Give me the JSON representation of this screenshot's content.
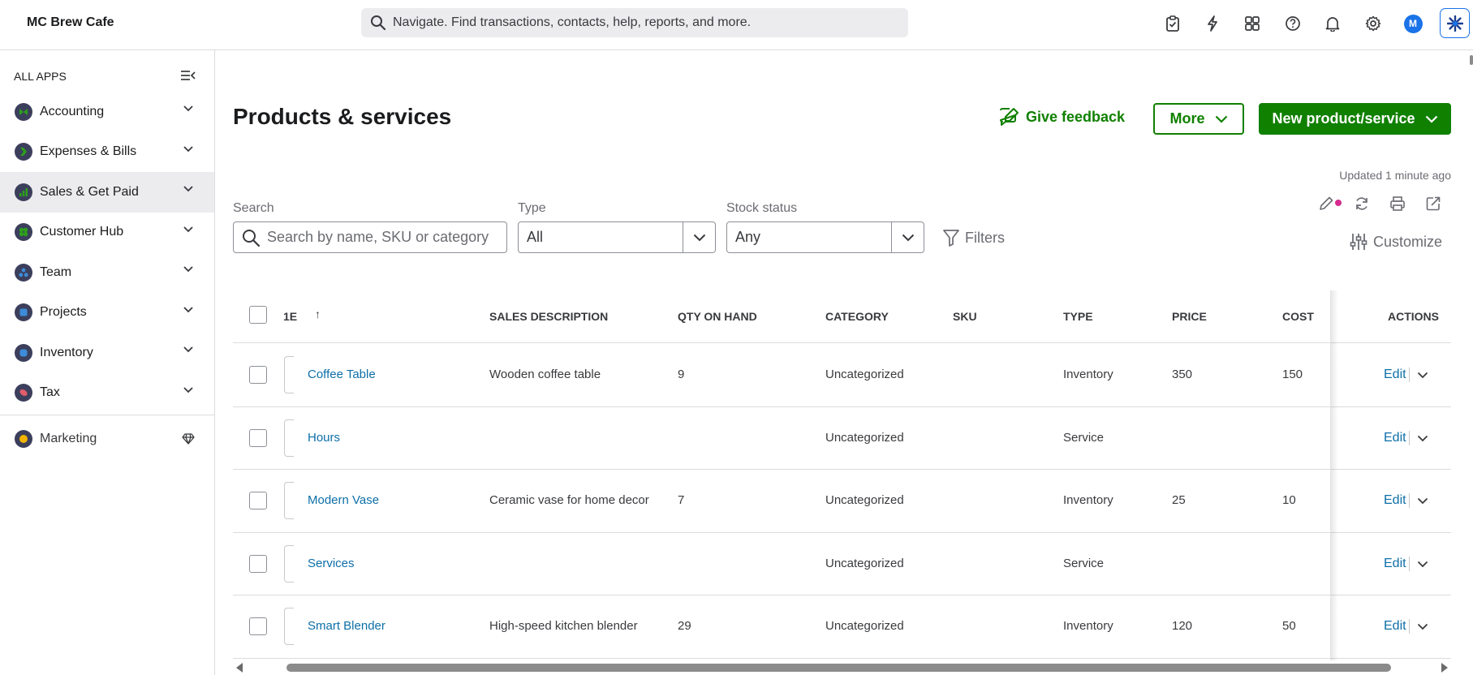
{
  "topbar": {
    "company_name": "MC Brew Cafe",
    "search_placeholder": "Navigate. Find transactions, contacts, help, reports, and more.",
    "avatar_initial": "M",
    "icons": [
      "clipboard-icon",
      "lightning-icon",
      "apps-icon",
      "help-icon",
      "bell-icon",
      "gear-icon",
      "avatar",
      "ai-assistant-icon"
    ]
  },
  "sidebar": {
    "heading": "ALL APPS",
    "items": [
      {
        "label": "Accounting",
        "icon_color": "#2ca01c"
      },
      {
        "label": "Expenses & Bills",
        "icon_color": "#2ca01c"
      },
      {
        "label": "Sales & Get Paid",
        "icon_color": "#2ca01c",
        "active": true
      },
      {
        "label": "Customer Hub",
        "icon_color": "#2ca01c"
      },
      {
        "label": "Team",
        "icon_color": "#3d8cd9"
      },
      {
        "label": "Projects",
        "icon_color": "#3d8cd9"
      },
      {
        "label": "Inventory",
        "icon_color": "#3d8cd9"
      },
      {
        "label": "Tax",
        "icon_color": "#e05c6b"
      }
    ],
    "marketing_label": "Marketing"
  },
  "page": {
    "title": "Products & services",
    "give_feedback": "Give feedback",
    "more_label": "More",
    "new_label": "New product/service",
    "updated_text": "Updated 1 minute ago",
    "customize_label": "Customize"
  },
  "filters": {
    "search_label": "Search",
    "search_placeholder": "Search by name, SKU or category",
    "type_label": "Type",
    "type_value": "All",
    "stock_label": "Stock status",
    "stock_value": "Any",
    "filters_label": "Filters"
  },
  "table": {
    "headers": {
      "name": "1E",
      "sort_arrow": "↑",
      "sales_description": "SALES DESCRIPTION",
      "qty_on_hand": "QTY ON HAND",
      "category": "CATEGORY",
      "sku": "SKU",
      "type": "TYPE",
      "price": "PRICE",
      "cost": "COST",
      "actions": "ACTIONS"
    },
    "edit_label": "Edit",
    "rows": [
      {
        "name": "Coffee Table",
        "description": "Wooden coffee table",
        "qty": "9",
        "category": "Uncategorized",
        "sku": "",
        "type": "Inventory",
        "price": "350",
        "cost": "150"
      },
      {
        "name": "Hours",
        "description": "",
        "qty": "",
        "category": "Uncategorized",
        "sku": "",
        "type": "Service",
        "price": "",
        "cost": ""
      },
      {
        "name": "Modern Vase",
        "description": "Ceramic vase for home decor",
        "qty": "7",
        "category": "Uncategorized",
        "sku": "",
        "type": "Inventory",
        "price": "25",
        "cost": "10"
      },
      {
        "name": "Services",
        "description": "",
        "qty": "",
        "category": "Uncategorized",
        "sku": "",
        "type": "Service",
        "price": "",
        "cost": ""
      },
      {
        "name": "Smart Blender",
        "description": "High-speed kitchen blender",
        "qty": "29",
        "category": "Uncategorized",
        "sku": "",
        "type": "Inventory",
        "price": "120",
        "cost": "50"
      }
    ]
  },
  "colors": {
    "brand_green": "#108000",
    "link_blue": "#0d6fa8",
    "notification_dot": "#d52b8f",
    "avatar_blue": "#1a73e8"
  }
}
